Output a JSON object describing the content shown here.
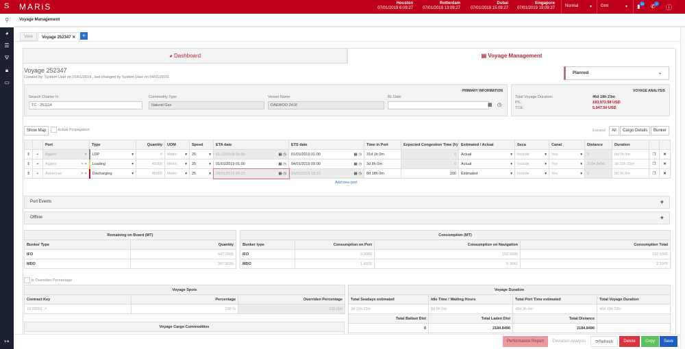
{
  "header": {
    "logo_mark": "S",
    "logo": "MARiS",
    "clocks": [
      {
        "city": "Houston",
        "time": "07/01/2019 6:09:27"
      },
      {
        "city": "Rotterdam",
        "time": "07/01/2019 13:09:27"
      },
      {
        "city": "Dubai",
        "time": "07/01/2019 15:09:27"
      },
      {
        "city": "Singapore",
        "time": "07/01/2019 19:09:27"
      }
    ],
    "mode": "Normal",
    "timezone": "Gmt",
    "notif_count": "15",
    "call_count": "0"
  },
  "breadcrumb": "Voyage Management",
  "tabs": {
    "view": "View",
    "voyage": "Voyage 252347"
  },
  "main_tabs": {
    "dashboard": "Dashboard",
    "voyage_management": "Voyage Management"
  },
  "voyage": {
    "title": "Voyage 252347",
    "created": "Created by: System User on 01/01/2019 , last changed by System User on 04/01/2019.",
    "status": "Planned"
  },
  "primary": {
    "heading": "PRIMARY INFORMATION",
    "charter_label": "Search Charter In",
    "charter": "TC - 251114",
    "commodity_label": "Commodity Type",
    "commodity": "Natural Gas",
    "vessel_label": "Vessel Name",
    "vessel": "DAEWOO 2418",
    "bl_label": "BL Date",
    "bl": ""
  },
  "analysis": {
    "heading": "VOYAGE ANALYSIS",
    "duration_label": "Total Voyage Duration:",
    "duration": "46d 18h 23m",
    "pl_label": "P/L:",
    "pl": "193,572.58 USD",
    "tce_label": "TCE:",
    "tce": "5,047.50 USD",
    "accent": "#c0001a"
  },
  "ports": {
    "show_map": "Show Map",
    "actual_propagation": "Actual Propagation",
    "expand": "Expand",
    "expand_all": "All",
    "cargo_details": "Cargo Details",
    "bunker": "Bunker",
    "add_port": "Add new port",
    "columns": [
      "Port",
      "Type",
      "Quantity",
      "UOM",
      "Speed",
      "ETA date",
      "ETS date",
      "Time in Port",
      "Expected Congestion Time (h)",
      "Estimated / Actual",
      "Seca",
      "Canal",
      "Distance",
      "Duration"
    ],
    "rows": [
      {
        "port": "Algiers",
        "type": "LDP",
        "color": "#8a7f7f",
        "qty": "0",
        "uom": "Metric",
        "speed": "25",
        "eta": "01/12/2018 00:00",
        "ets": "01/01/2019 01:00",
        "tip": "31d 1h 0m",
        "cong": "0",
        "ea": "Actual",
        "seca": "Include",
        "canal": "Yes",
        "dist": "0",
        "dur": "0d 0h 0m"
      },
      {
        "port": "Algiers",
        "type": "Loading",
        "color": "#c8d96f",
        "qty": "45000",
        "uom": "Metric",
        "speed": "25",
        "eta": "01/01/2019 01:00",
        "ets": "04/01/2019 09:00",
        "tip": "3d 8h 0m",
        "cong": "0",
        "ea": "Actual",
        "seca": "Include",
        "canal": "Yes",
        "dist": "2184.8496",
        "dur": "3d 15h 23m"
      },
      {
        "port": "Aabenraa",
        "type": "Discharging",
        "color": "#c0001a",
        "qty": "45000",
        "uom": "Metric",
        "speed": "25",
        "eta": "08/01/2019 00:23",
        "ets": "16/01/2019 18:23",
        "tip": "8d 18h 0m",
        "cong": "200",
        "ea": "Estimated",
        "seca": "Include",
        "canal": "Yes",
        "dist": "0",
        "dur": "0d 0h 0m"
      }
    ]
  },
  "sections": {
    "port_events": "Port Events",
    "offhire": "Offhire"
  },
  "rob": {
    "title": "Remaining on Board (MT)",
    "col1": "Bunker Type",
    "col2": "Quantity",
    "rows": [
      [
        "IFO",
        "647.0605"
      ],
      [
        "MDO",
        "397.8025"
      ]
    ]
  },
  "consumption": {
    "title": "Consumption (MT)",
    "cols": [
      "Bunker type",
      "Consumption on Port",
      "Consumption on Navigation",
      "Consumption Total"
    ],
    "rows": [
      [
        "IFO",
        "0.0000",
        "152.9395",
        "152.9395"
      ],
      [
        "MDO",
        "1.8333",
        "0.3641",
        "2.1975"
      ]
    ]
  },
  "override_label": "Is Overriden Percentage",
  "spots": {
    "title": "Voyage Spots",
    "cols": [
      "Contract Key",
      "Percentage",
      "Overriden Percentage"
    ],
    "row": [
      "19.00001",
      "100 %",
      "100.000"
    ]
  },
  "commodities": {
    "title": "Voyage Cargo Commodities"
  },
  "duration": {
    "title": "Voyage Duration",
    "cols": [
      "Total Seadays estimated",
      "Idle Time / Waiting Hours",
      "Total Port Time estimated",
      "Total Voyage Duration"
    ],
    "vals": [
      "3d 15h 23m",
      "8d 8h 0m",
      "43d 3h 0m",
      "46d 18h 23m"
    ],
    "dist_cols": [
      "Total Ballast Dist",
      "Total Laden Dist",
      "Total Distance"
    ],
    "dist_vals": [
      "0",
      "2184.8496",
      "2184.8496"
    ]
  },
  "footer": {
    "performance": "Performance Report",
    "deviation": "Deviation Analysis",
    "refresh": "Refresh",
    "delete": "Delete",
    "copy": "Copy",
    "save": "Save"
  }
}
